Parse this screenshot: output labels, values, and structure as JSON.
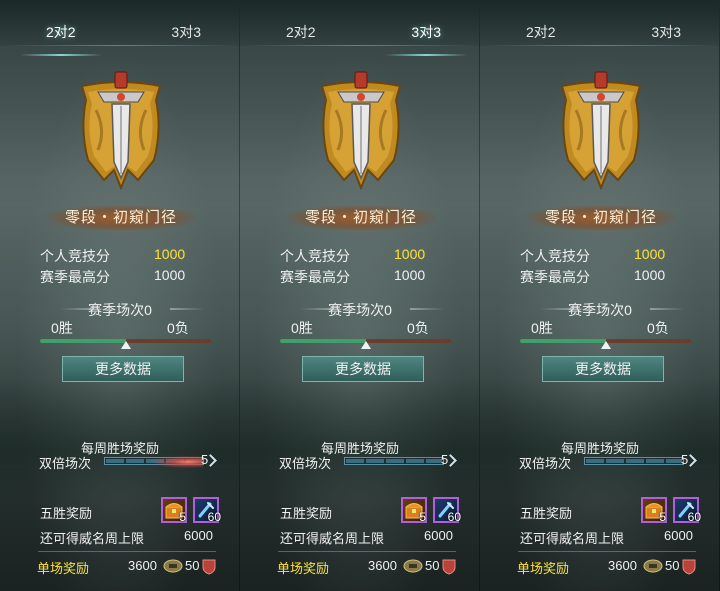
{
  "panels": [
    {
      "tabs": {
        "left": "2对2",
        "right": "3对3",
        "active": "left"
      },
      "rank": "零段・初窥门径",
      "personal_score_label": "个人竞技分",
      "personal_score": "1000",
      "season_high_label": "赛季最高分",
      "season_high": "1000",
      "season_matches": "赛季场次0",
      "wins": "0胜",
      "losses": "0负",
      "win_ratio": 0.5,
      "more_data_button": "更多数据",
      "weekly_title": "每周胜场奖励",
      "double_label": "双倍场次",
      "double_count": "5",
      "double_glow": true,
      "five_win_label": "五胜奖励",
      "reward_item_1_count": "5",
      "reward_item_2_count": "60",
      "cap_label": "还可得威名周上限",
      "cap_value": "6000",
      "single_label": "单场奖励",
      "single_value_1": "3600",
      "single_value_2": "50"
    },
    {
      "tabs": {
        "left": "2对2",
        "right": "3对3",
        "active": "right"
      },
      "rank": "零段・初窥门径",
      "personal_score_label": "个人竞技分",
      "personal_score": "1000",
      "season_high_label": "赛季最高分",
      "season_high": "1000",
      "season_matches": "赛季场次0",
      "wins": "0胜",
      "losses": "0负",
      "win_ratio": 0.5,
      "more_data_button": "更多数据",
      "weekly_title": "每周胜场奖励",
      "double_label": "双倍场次",
      "double_count": "5",
      "double_glow": false,
      "five_win_label": "五胜奖励",
      "reward_item_1_count": "5",
      "reward_item_2_count": "60",
      "cap_label": "还可得威名周上限",
      "cap_value": "6000",
      "single_label": "单场奖励",
      "single_value_1": "3600",
      "single_value_2": "50"
    },
    {
      "tabs": {
        "left": "2对2",
        "right": "3对3",
        "active": "none"
      },
      "rank": "零段・初窥门径",
      "personal_score_label": "个人竞技分",
      "personal_score": "1000",
      "season_high_label": "赛季最高分",
      "season_high": "1000",
      "season_matches": "赛季场次0",
      "wins": "0胜",
      "losses": "0负",
      "win_ratio": 0.5,
      "more_data_button": "更多数据",
      "weekly_title": "每周胜场奖励",
      "double_label": "双倍场次",
      "double_count": "5",
      "double_glow": false,
      "five_win_label": "五胜奖励",
      "reward_item_1_count": "5",
      "reward_item_2_count": "60",
      "cap_label": "还可得威名周上限",
      "cap_value": "6000",
      "single_label": "单场奖励",
      "single_value_1": "3600",
      "single_value_2": "50"
    }
  ],
  "colors": {
    "gold_text": "#ffe23a",
    "win_bar": "#3fa06a",
    "loss_bar": "#6a3e2a",
    "button": "#3f736e",
    "rank_banner": "#a85a1e",
    "item_border": "#b060d8"
  },
  "icons": [
    "sword-banner-emblem-icon",
    "treasure-chest-icon",
    "scroll-item-icon",
    "coin-icon",
    "shield-icon",
    "chevron-right-icon"
  ]
}
